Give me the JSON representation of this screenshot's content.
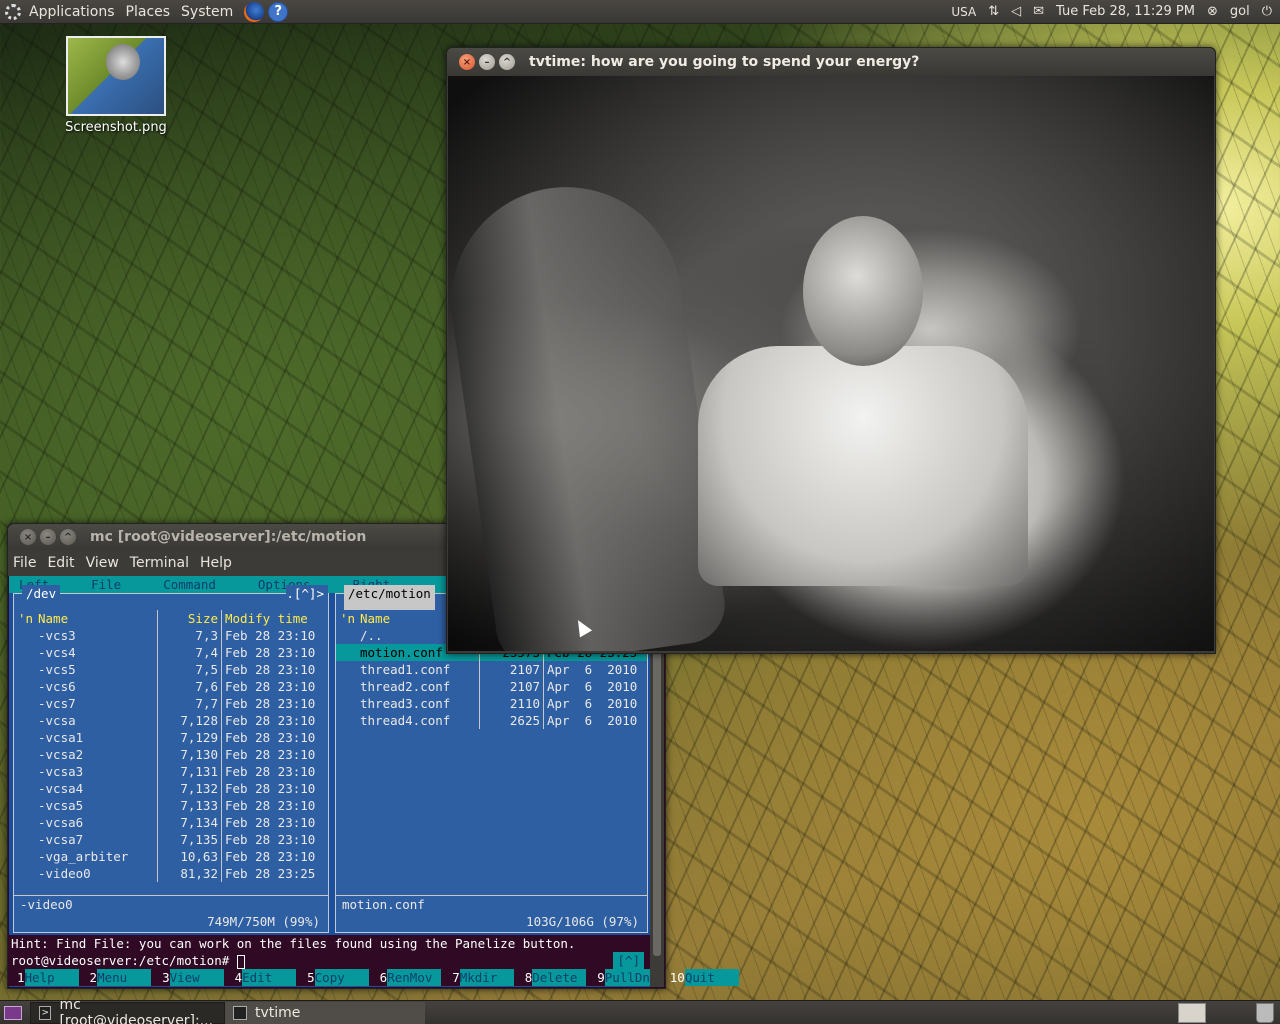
{
  "top_panel": {
    "menus": [
      "Applications",
      "Places",
      "System"
    ],
    "keyboard": "USA",
    "datetime": "Tue Feb 28, 11:29 PM",
    "user": "gol"
  },
  "desktop": {
    "icon_label": "Screenshot.png"
  },
  "tvtime": {
    "title": "tvtime: how are you going to spend your energy?"
  },
  "mc": {
    "title": "mc [root@videoserver]:/etc/motion",
    "menubar": [
      "File",
      "Edit",
      "View",
      "Terminal",
      "Help"
    ],
    "mc_menu": [
      "Left",
      "File",
      "Command",
      "Options",
      "Right"
    ],
    "left_panel": {
      "path": "/dev",
      "corner": ".[^]>",
      "headers": {
        "n": "'n",
        "name": "Name",
        "size": "Size",
        "time": "Modify time"
      },
      "rows": [
        {
          "name": "-vcs3",
          "size": "7,3",
          "time": "Feb 28 23:10"
        },
        {
          "name": "-vcs4",
          "size": "7,4",
          "time": "Feb 28 23:10"
        },
        {
          "name": "-vcs5",
          "size": "7,5",
          "time": "Feb 28 23:10"
        },
        {
          "name": "-vcs6",
          "size": "7,6",
          "time": "Feb 28 23:10"
        },
        {
          "name": "-vcs7",
          "size": "7,7",
          "time": "Feb 28 23:10"
        },
        {
          "name": "-vcsa",
          "size": "7,128",
          "time": "Feb 28 23:10"
        },
        {
          "name": "-vcsa1",
          "size": "7,129",
          "time": "Feb 28 23:10"
        },
        {
          "name": "-vcsa2",
          "size": "7,130",
          "time": "Feb 28 23:10"
        },
        {
          "name": "-vcsa3",
          "size": "7,131",
          "time": "Feb 28 23:10"
        },
        {
          "name": "-vcsa4",
          "size": "7,132",
          "time": "Feb 28 23:10"
        },
        {
          "name": "-vcsa5",
          "size": "7,133",
          "time": "Feb 28 23:10"
        },
        {
          "name": "-vcsa6",
          "size": "7,134",
          "time": "Feb 28 23:10"
        },
        {
          "name": "-vcsa7",
          "size": "7,135",
          "time": "Feb 28 23:10"
        },
        {
          "name": "-vga_arbiter",
          "size": "10,63",
          "time": "Feb 28 23:10"
        },
        {
          "name": "-video0",
          "size": "81,32",
          "time": "Feb 28 23:25"
        }
      ],
      "status": "-video0",
      "free": "749M/750M (99%)"
    },
    "right_panel": {
      "path": "/etc/motion",
      "headers": {
        "n": "'n",
        "name": "Name"
      },
      "rows": [
        {
          "name": "/..",
          "size": "",
          "time": ""
        },
        {
          "name": "motion.conf",
          "size": "23573",
          "time": "Feb 28 23:25"
        },
        {
          "name": "thread1.conf",
          "size": "2107",
          "time": "Apr  6  2010"
        },
        {
          "name": "thread2.conf",
          "size": "2107",
          "time": "Apr  6  2010"
        },
        {
          "name": "thread3.conf",
          "size": "2110",
          "time": "Apr  6  2010"
        },
        {
          "name": "thread4.conf",
          "size": "2625",
          "time": "Apr  6  2010"
        }
      ],
      "status": "motion.conf",
      "free": "103G/106G (97%)",
      "corner": "[^]"
    },
    "hint": "Hint: Find File: you can work on the files found using the Panelize button.",
    "prompt": "root@videoserver:/etc/motion#",
    "fkeys": [
      {
        "num": "1",
        "label": "Help"
      },
      {
        "num": "2",
        "label": "Menu"
      },
      {
        "num": "3",
        "label": "View"
      },
      {
        "num": "4",
        "label": "Edit"
      },
      {
        "num": "5",
        "label": "Copy"
      },
      {
        "num": "6",
        "label": "RenMov"
      },
      {
        "num": "7",
        "label": "Mkdir"
      },
      {
        "num": "8",
        "label": "Delete"
      },
      {
        "num": "9",
        "label": "PullDn"
      },
      {
        "num": "10",
        "label": "Quit"
      }
    ]
  },
  "taskbar": {
    "tasks": [
      "mc [root@videoserver]:...",
      "tvtime"
    ]
  }
}
